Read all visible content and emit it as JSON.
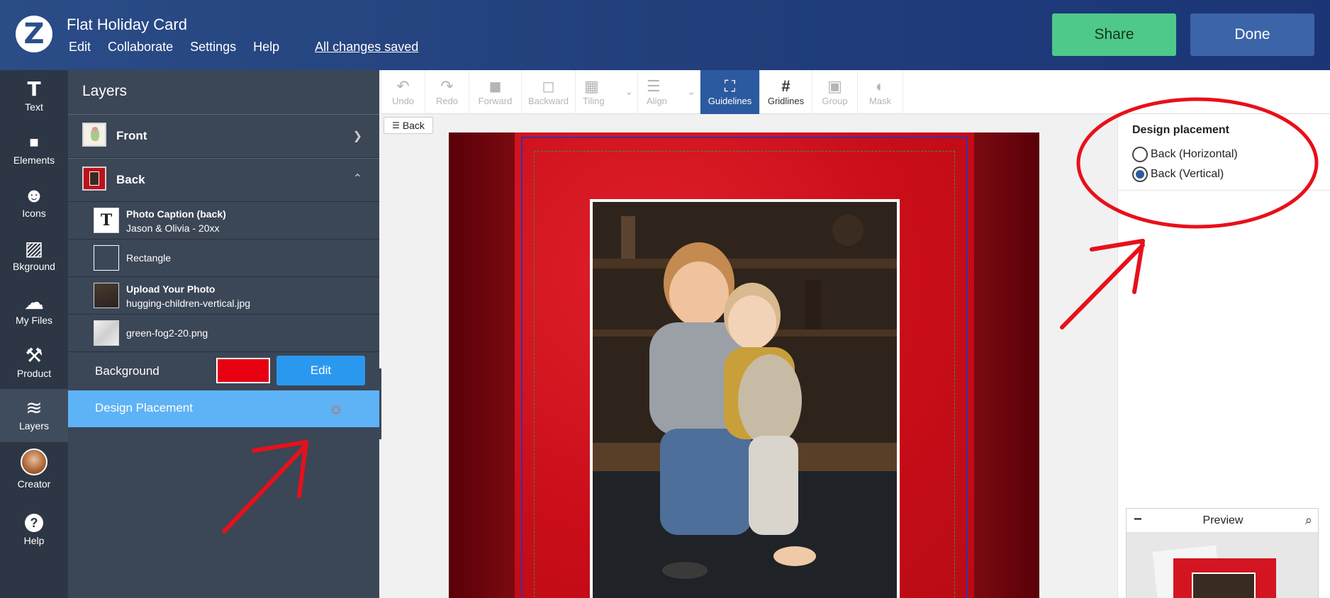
{
  "header": {
    "logo": "Z",
    "title": "Flat Holiday Card",
    "menu": [
      "Edit",
      "Collaborate",
      "Settings",
      "Help"
    ],
    "saved_status": "All changes saved",
    "share_label": "Share",
    "done_label": "Done"
  },
  "rail": [
    {
      "label": "Text",
      "icon": "T"
    },
    {
      "label": "Elements",
      "icon": "■"
    },
    {
      "label": "Icons",
      "icon": "☻"
    },
    {
      "label": "Bkground",
      "icon": "▨"
    },
    {
      "label": "My Files",
      "icon": "☁"
    },
    {
      "label": "Product",
      "icon": "⚒"
    },
    {
      "label": "Layers",
      "icon": "≋"
    },
    {
      "label": "Creator",
      "icon": "●"
    },
    {
      "label": "Help",
      "icon": "?"
    }
  ],
  "layers": {
    "title": "Layers",
    "front_label": "Front",
    "back_label": "Back",
    "items": [
      {
        "title": "Photo Caption (back)",
        "subtitle": "Jason & Olivia - 20xx",
        "thumb_glyph": "T"
      },
      {
        "title": "",
        "subtitle": "Rectangle"
      },
      {
        "title": "Upload Your Photo",
        "subtitle": "hugging-children-vertical.jpg"
      },
      {
        "title": "",
        "subtitle": "green-fog2-20.png"
      }
    ],
    "background_label": "Background",
    "background_color": "#e60012",
    "edit_label": "Edit",
    "design_placement_label": "Design Placement"
  },
  "toolbar": [
    {
      "label": "Undo",
      "icon": "↶"
    },
    {
      "label": "Redo",
      "icon": "↷"
    },
    {
      "label": "Forward",
      "icon": "◼"
    },
    {
      "label": "Backward",
      "icon": "◻"
    },
    {
      "label": "Tiling",
      "icon": "▦"
    },
    {
      "label": "Align",
      "icon": "☰"
    },
    {
      "label": "Guidelines",
      "icon": "⛶"
    },
    {
      "label": "Gridlines",
      "icon": "#"
    },
    {
      "label": "Group",
      "icon": "▣"
    },
    {
      "label": "Mask",
      "icon": "◐"
    }
  ],
  "canvas": {
    "back_button": "Back"
  },
  "design_placement": {
    "title": "Design placement",
    "options": [
      "Back (Horizontal)",
      "Back (Vertical)"
    ],
    "selected": "Back (Vertical)"
  },
  "preview": {
    "title": "Preview",
    "minimize": "−",
    "search_icon": "⌕"
  }
}
